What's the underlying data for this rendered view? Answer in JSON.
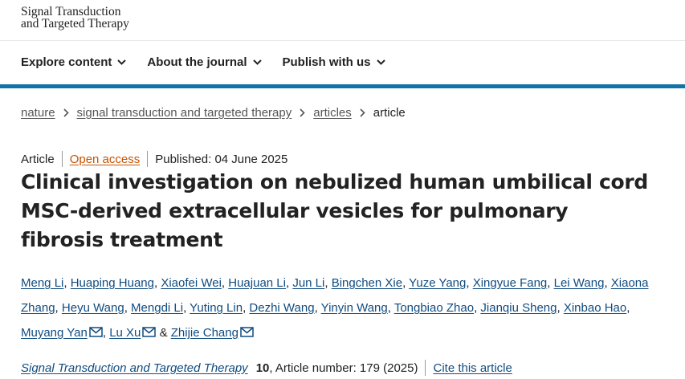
{
  "logo": {
    "line1": "Signal Transduction",
    "line2": "and Targeted Therapy"
  },
  "nav": {
    "items": [
      {
        "label": "Explore content"
      },
      {
        "label": "About the journal"
      },
      {
        "label": "Publish with us"
      }
    ]
  },
  "breadcrumb": {
    "items": [
      "nature",
      "signal transduction and targeted therapy",
      "articles"
    ],
    "current": "article"
  },
  "article": {
    "type": "Article",
    "access": "Open access",
    "published": "Published: 04 June 2025",
    "title": "Clinical investigation on nebulized human umbilical cord MSC-derived extracellular vesicles for pulmonary fibrosis treatment"
  },
  "authors": [
    "Meng Li",
    "Huaping Huang",
    "Xiaofei Wei",
    "Huajuan Li",
    "Jun Li",
    "Bingchen Xie",
    "Yuze Yang",
    "Xingyue Fang",
    "Lei Wang",
    "Xiaona Zhang",
    "Heyu Wang",
    "Mengdi Li",
    "Yuting Lin",
    "Dezhi Wang",
    "Yinyin Wang",
    "Tongbiao Zhao",
    "Jianqiu Sheng",
    "Xinbao Hao",
    "Muyang Yan",
    "Lu Xu",
    "&",
    "Zhijie Chang"
  ],
  "citation": {
    "journal": "Signal Transduction and Targeted Therapy",
    "volume": "10",
    "article_number": ", Article number: 179 (2025)",
    "cite_label": "Cite this article"
  },
  "colors": {
    "accent_bar": "#0f74a8",
    "link": "#0f4c81",
    "open_access": "#c65301"
  }
}
